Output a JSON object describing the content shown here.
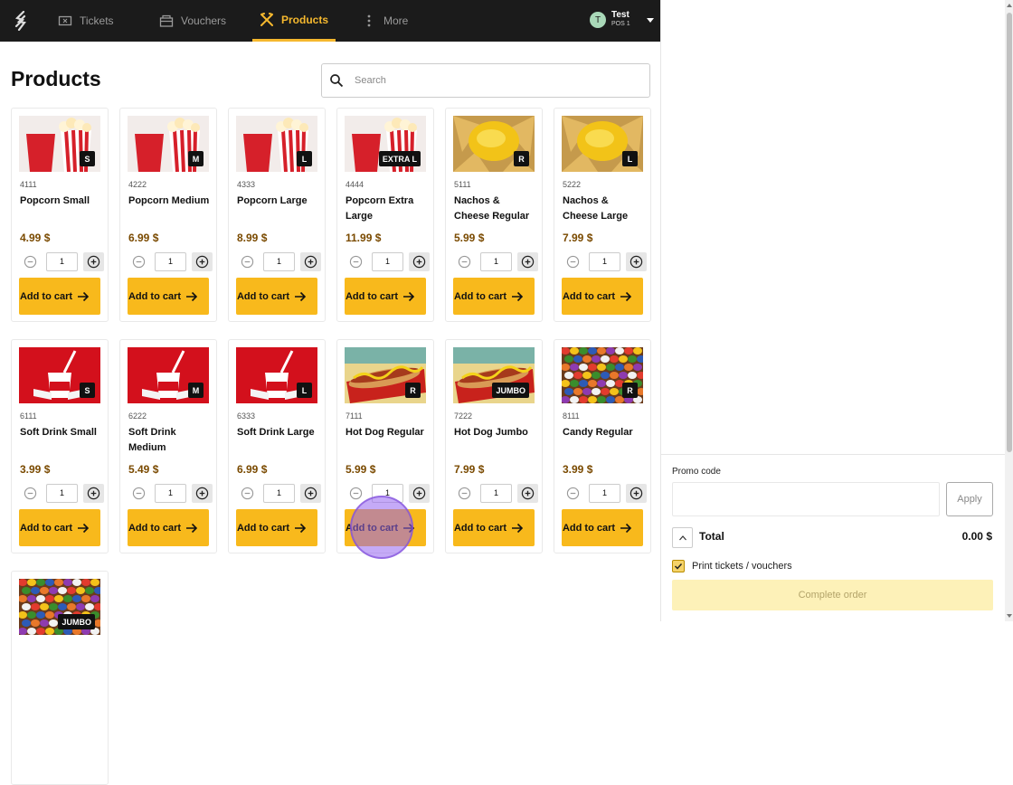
{
  "nav": {
    "items": [
      {
        "label": "Tickets",
        "icon": "ticket-icon"
      },
      {
        "label": "Vouchers",
        "icon": "voucher-icon"
      },
      {
        "label": "Products",
        "icon": "utensils-icon",
        "active": true
      },
      {
        "label": "More",
        "icon": "more-vertical-icon"
      }
    ],
    "user": {
      "initial": "T",
      "name": "Test",
      "pos": "POS 1"
    }
  },
  "main": {
    "title": "Products",
    "search_placeholder": "Search",
    "add_label": "Add to cart",
    "products": [
      {
        "code": "4111",
        "name": "Popcorn Small",
        "price": "4.99 $",
        "qty": "1",
        "badge": "S",
        "image": "popcorn"
      },
      {
        "code": "4222",
        "name": "Popcorn Medium",
        "price": "6.99 $",
        "qty": "1",
        "badge": "M",
        "image": "popcorn"
      },
      {
        "code": "4333",
        "name": "Popcorn Large",
        "price": "8.99 $",
        "qty": "1",
        "badge": "L",
        "image": "popcorn"
      },
      {
        "code": "4444",
        "name": "Popcorn Extra Large",
        "price": "11.99 $",
        "qty": "1",
        "badge": "EXTRA L",
        "image": "popcorn"
      },
      {
        "code": "5111",
        "name": "Nachos & Cheese Regular",
        "price": "5.99 $",
        "qty": "1",
        "badge": "R",
        "image": "nachos"
      },
      {
        "code": "5222",
        "name": "Nachos & Cheese Large",
        "price": "7.99 $",
        "qty": "1",
        "badge": "L",
        "image": "nachos"
      },
      {
        "code": "6111",
        "name": "Soft Drink Small",
        "price": "3.99 $",
        "qty": "1",
        "badge": "S",
        "image": "drink"
      },
      {
        "code": "6222",
        "name": "Soft Drink Medium",
        "price": "5.49 $",
        "qty": "1",
        "badge": "M",
        "image": "drink"
      },
      {
        "code": "6333",
        "name": "Soft Drink Large",
        "price": "6.99 $",
        "qty": "1",
        "badge": "L",
        "image": "drink"
      },
      {
        "code": "7111",
        "name": "Hot Dog Regular",
        "price": "5.99 $",
        "qty": "1",
        "badge": "R",
        "image": "hotdog"
      },
      {
        "code": "7222",
        "name": "Hot Dog Jumbo",
        "price": "7.99 $",
        "qty": "1",
        "badge": "JUMBO",
        "image": "hotdog"
      },
      {
        "code": "8111",
        "name": "Candy Regular",
        "price": "3.99 $",
        "qty": "1",
        "badge": "R",
        "image": "candy"
      },
      {
        "code": "",
        "name": "",
        "price": "",
        "qty": "",
        "badge": "JUMBO",
        "image": "candy"
      }
    ]
  },
  "cart": {
    "promo_label": "Promo code",
    "promo_value": "",
    "apply_label": "Apply",
    "total_label": "Total",
    "total_value": "0.00 $",
    "print_label": "Print tickets / vouchers",
    "print_checked": true,
    "complete_label": "Complete order"
  },
  "colors": {
    "accent": "#f8b91c",
    "nav_bg": "#1b1b1b",
    "price": "#7a4a00"
  }
}
